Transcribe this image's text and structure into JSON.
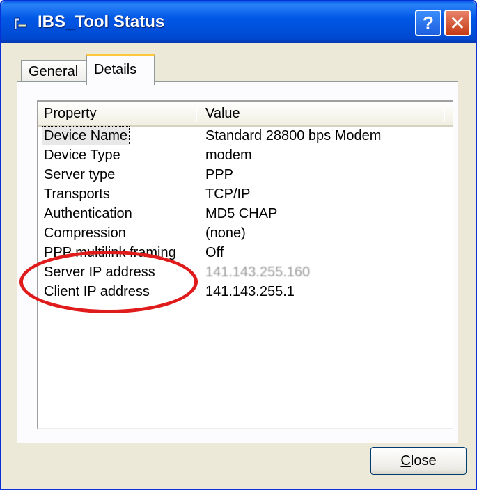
{
  "window": {
    "title": "IBS_Tool Status",
    "help_label": "?",
    "close_label": "✕"
  },
  "tabs": [
    {
      "label": "General",
      "active": false
    },
    {
      "label": "Details",
      "active": true
    }
  ],
  "list": {
    "columns": [
      "Property",
      "Value"
    ],
    "rows": [
      {
        "property": "Device Name",
        "value": "Standard 28800 bps Modem",
        "selected": true
      },
      {
        "property": "Device Type",
        "value": "modem"
      },
      {
        "property": "Server type",
        "value": "PPP"
      },
      {
        "property": "Transports",
        "value": "TCP/IP"
      },
      {
        "property": "Authentication",
        "value": "MD5 CHAP"
      },
      {
        "property": "Compression",
        "value": "(none)"
      },
      {
        "property": "PPP multilink framing",
        "value": "Off"
      },
      {
        "property": "Server IP address",
        "value": "141.143.255.160",
        "blurred": true
      },
      {
        "property": "Client IP address",
        "value": "141.143.255.1"
      }
    ]
  },
  "footer": {
    "close_button": {
      "mnemonic": "C",
      "rest": "lose"
    }
  },
  "colors": {
    "titlebar": "#0058e6",
    "annotation": "#e01b1b",
    "tab_accent": "#ffc83c"
  }
}
